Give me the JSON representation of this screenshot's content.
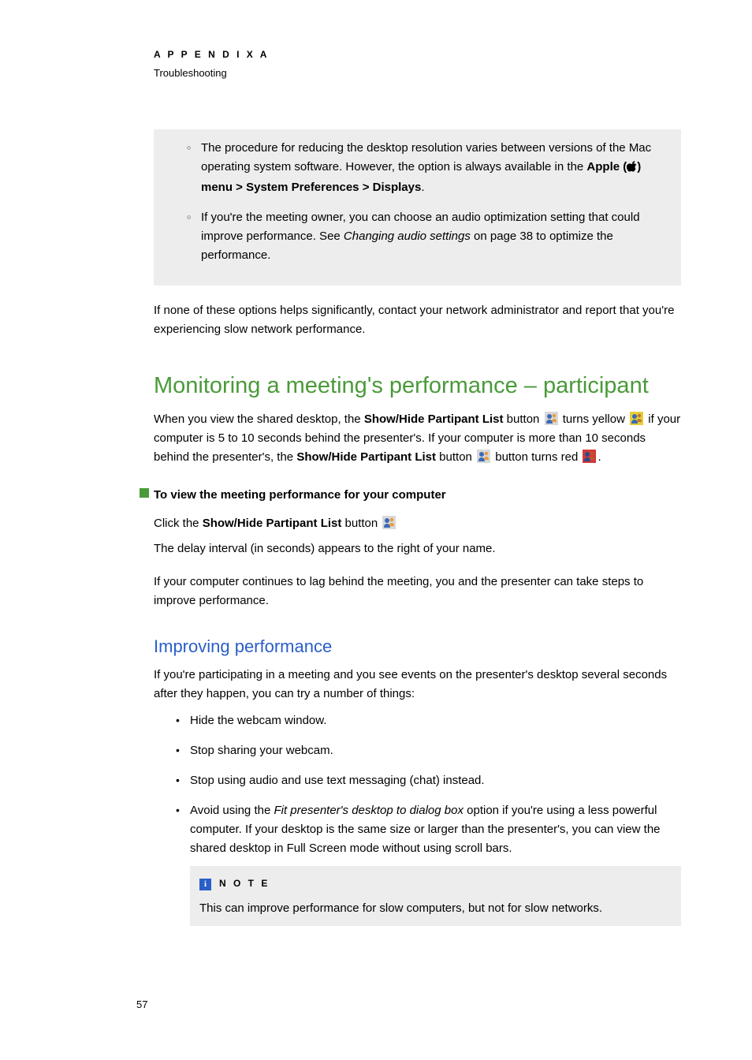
{
  "header": {
    "appendix": "A P P E N D I X   A",
    "sub": "Troubleshooting"
  },
  "graybox1": {
    "item1_pre": "The procedure for reducing the desktop resolution varies between versions of the Mac operating system software. However, the option is always available in the ",
    "item1_apple": "Apple (",
    "item1_menu": ") menu > System Preferences > Displays",
    "item1_end": ".",
    "item2_pre": "If you're the meeting owner, you can choose an audio optimization setting that could improve performance. See ",
    "item2_link": "Changing audio settings",
    "item2_post": " on page 38 to optimize the performance."
  },
  "para1": "If none of these options helps significantly, contact your network administrator and report that you're experiencing slow network performance.",
  "h1": "Monitoring a meeting's performance – participant",
  "para2": {
    "pre": "When you view the shared desktop, the ",
    "b1": "Show/Hide Partipant List",
    "mid1": " button ",
    "mid2": " turns yellow ",
    "mid3": " if your computer is 5 to 10 seconds behind the presenter's. If your computer is more than 10 seconds behind the presenter's, the ",
    "b2": "Show/Hide Partipant List",
    "mid4": " button ",
    "mid5": " button turns red ",
    "end": "."
  },
  "task": "To view the meeting performance for your computer",
  "para3": {
    "pre": "Click the ",
    "b": "Show/Hide Partipant List",
    "post": " button "
  },
  "para4": "The delay interval (in seconds) appears to the right of your name.",
  "para5": "If your computer continues to lag behind the meeting, you and the presenter can take steps to improve performance.",
  "h2": "Improving performance",
  "para6": "If you're participating in a meeting and you see events on the presenter's desktop several seconds after they happen, you can try a number of things:",
  "bullets": {
    "b1": "Hide the webcam window.",
    "b2": "Stop sharing your webcam.",
    "b3": "Stop using audio and use text messaging (chat) instead.",
    "b4_pre": "Avoid using the ",
    "b4_i": "Fit presenter's desktop to dialog box",
    "b4_post": " option if you're using a less powerful computer. If your desktop is the same size or larger than the presenter's, you can view the shared desktop in Full Screen mode without using scroll bars."
  },
  "note": {
    "label": "N O T E",
    "body": "This can improve performance for slow computers, but not for slow networks."
  },
  "pagenum": "57"
}
